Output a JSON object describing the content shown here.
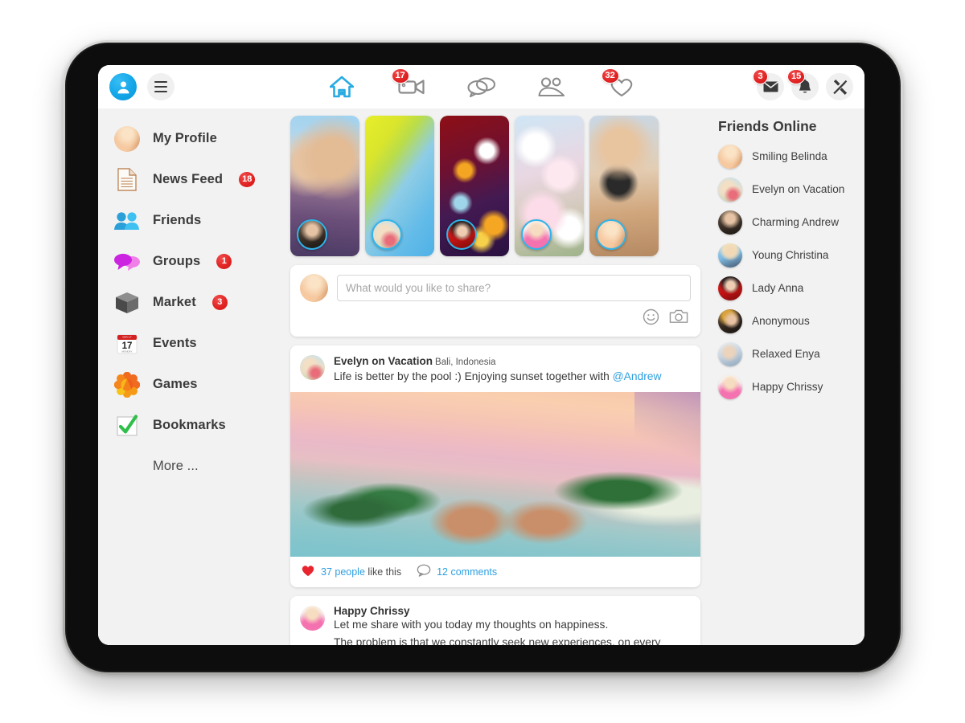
{
  "topbar": {
    "profile_icon": "person-avatar-icon",
    "menu_icon": "hamburger-menu-icon",
    "nav": [
      {
        "name": "home",
        "icon": "home-icon",
        "badge": ""
      },
      {
        "name": "video",
        "icon": "video-camera-icon",
        "badge": "17"
      },
      {
        "name": "chat",
        "icon": "chat-bubbles-icon",
        "badge": ""
      },
      {
        "name": "people",
        "icon": "people-icon",
        "badge": ""
      },
      {
        "name": "likes",
        "icon": "heart-icon",
        "badge": "32"
      }
    ],
    "right": [
      {
        "name": "messages",
        "icon": "envelope-icon",
        "badge": "3"
      },
      {
        "name": "notifications",
        "icon": "bell-icon",
        "badge": "15"
      },
      {
        "name": "settings",
        "icon": "tools-icon",
        "badge": ""
      }
    ]
  },
  "sidebar": {
    "items": [
      {
        "label": "My Profile",
        "icon": "profile-photo-icon",
        "badge": ""
      },
      {
        "label": "News Feed",
        "icon": "document-icon",
        "badge": "18"
      },
      {
        "label": "Friends",
        "icon": "two-people-icon",
        "badge": ""
      },
      {
        "label": "Groups",
        "icon": "speech-bubbles-icon",
        "badge": "1"
      },
      {
        "label": "Market",
        "icon": "box-icon",
        "badge": "3"
      },
      {
        "label": "Events",
        "icon": "calendar-icon",
        "badge": ""
      },
      {
        "label": "Games",
        "icon": "pinwheel-icon",
        "badge": ""
      },
      {
        "label": "Bookmarks",
        "icon": "checkmark-icon",
        "badge": ""
      },
      {
        "label": "More ...",
        "icon": "",
        "badge": ""
      }
    ],
    "calendar_icon": {
      "day": "17",
      "weekday": "MONDAY"
    }
  },
  "stories": [
    {
      "name": "couple-selfie-story",
      "art": "s-couple",
      "avatar_art": "p-andrew"
    },
    {
      "name": "palm-leaf-story",
      "art": "s-palm",
      "avatar_art": "p-evelyn"
    },
    {
      "name": "city-bokeh-story",
      "art": "s-bokeh",
      "avatar_art": "p-anna"
    },
    {
      "name": "cherry-blossom-story",
      "art": "s-blossom",
      "avatar_art": "p-chrissy"
    },
    {
      "name": "fitness-beach-story",
      "art": "s-sport",
      "avatar_art": "p-belinda"
    }
  ],
  "composer": {
    "placeholder": "What would you like to share?",
    "value": "",
    "emoji_icon": "smiley-face-icon",
    "camera_icon": "camera-icon",
    "avatar_art": "p-belinda"
  },
  "posts": [
    {
      "author": "Evelyn on Vacation",
      "location": "Bali, Indonesia",
      "text_before_mention": "Life is better by the pool :) Enjoying sunset together with ",
      "mention": "@Andrew",
      "avatar_art": "p-evelyn",
      "image_name": "sunset-infinity-pool-photo",
      "likes_count": "37 people",
      "likes_suffix": "like this",
      "comments": "12 comments",
      "heart_icon": "heart-filled-icon",
      "comment_icon": "comment-bubble-icon"
    },
    {
      "author": "Happy Chrissy",
      "avatar_art": "p-chrissy",
      "lines": [
        "Let me share with you today my thoughts on happiness.",
        "The problem is that we constantly seek new experiences, on every adventure our mind responds with new wishes. We always want something more and better. But happiness lies in not needing more"
      ]
    }
  ],
  "rail": {
    "title": "Friends Online",
    "friends": [
      {
        "name": "Smiling Belinda",
        "art": "p-belinda"
      },
      {
        "name": "Evelyn on Vacation",
        "art": "p-evelyn"
      },
      {
        "name": "Charming Andrew",
        "art": "p-andrew"
      },
      {
        "name": "Young Christina",
        "art": "p-christina"
      },
      {
        "name": "Lady Anna",
        "art": "p-anna"
      },
      {
        "name": "Anonymous",
        "art": "p-anon"
      },
      {
        "name": "Relaxed Enya",
        "art": "p-enya"
      },
      {
        "name": "Happy Chrissy",
        "art": "p-chrissy"
      }
    ]
  },
  "colors": {
    "accent_blue": "#13a6e8",
    "badge_red": "#e12222",
    "link_blue": "#2e9fe0",
    "page_bg": "#f2f2f2",
    "card_white": "#ffffff"
  }
}
